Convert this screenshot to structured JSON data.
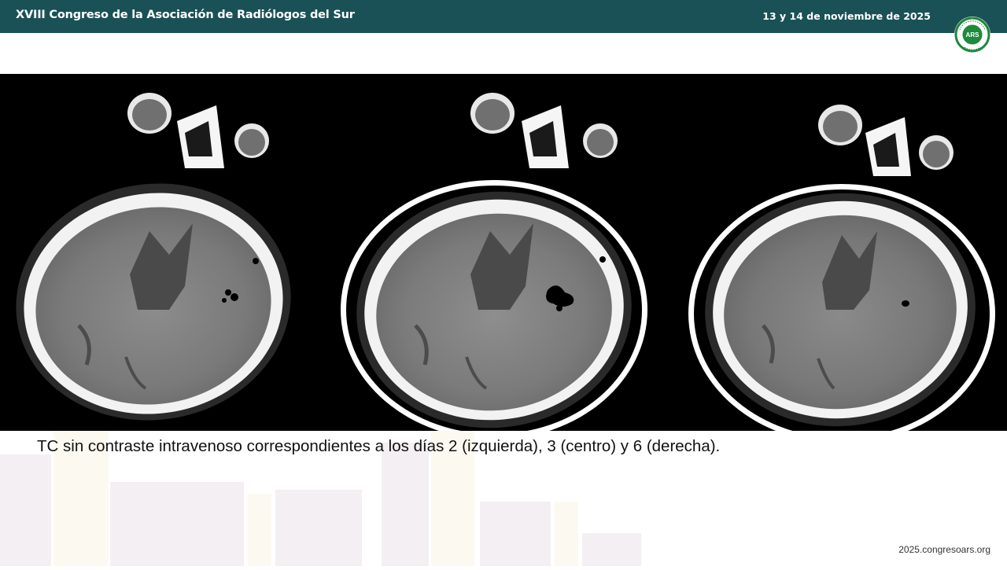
{
  "header": {
    "title": "XVIII Congreso de la Asociación de Radiólogos del Sur",
    "date": "13 y 14 de noviembre de 2025"
  },
  "logo": {
    "center_text": "ARS",
    "ring_text_top": "ASOCIACIÓN RADIÓLOGOS",
    "ring_text_bottom": "SUR",
    "color": "#1e8a3c"
  },
  "images": [
    {
      "icon": "ct-brain-axial-day-2"
    },
    {
      "icon": "ct-brain-axial-day-3"
    },
    {
      "icon": "ct-brain-axial-day-6"
    }
  ],
  "caption": "TC sin contraste intravenoso correspondientes a los días 2 (izquierda), 3 (centro) y 6 (derecha).",
  "footer": {
    "url": "2025.congresoars.org"
  },
  "colors": {
    "header_bg": "#1a5156",
    "header_text": "#ffffff"
  }
}
